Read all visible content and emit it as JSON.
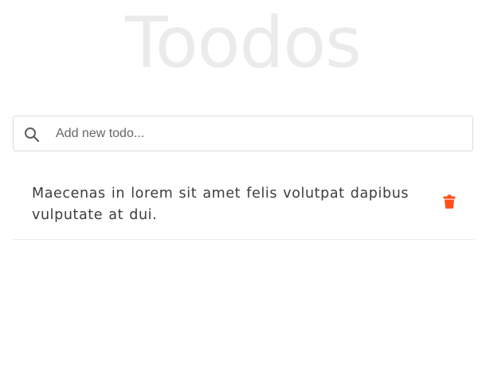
{
  "header": {
    "title": "Toodos"
  },
  "new_todo": {
    "placeholder": "Add new todo...",
    "value": "",
    "icon": "search-icon"
  },
  "todos": [
    {
      "text": "Maecenas in lorem sit amet felis volutpat dapibus vulputate at dui.",
      "delete_icon": "trash-icon"
    }
  ],
  "colors": {
    "title": "#ebebeb",
    "delete": "#ff4e1a",
    "border": "#dcdcdc",
    "text": "#3d3d3d"
  }
}
